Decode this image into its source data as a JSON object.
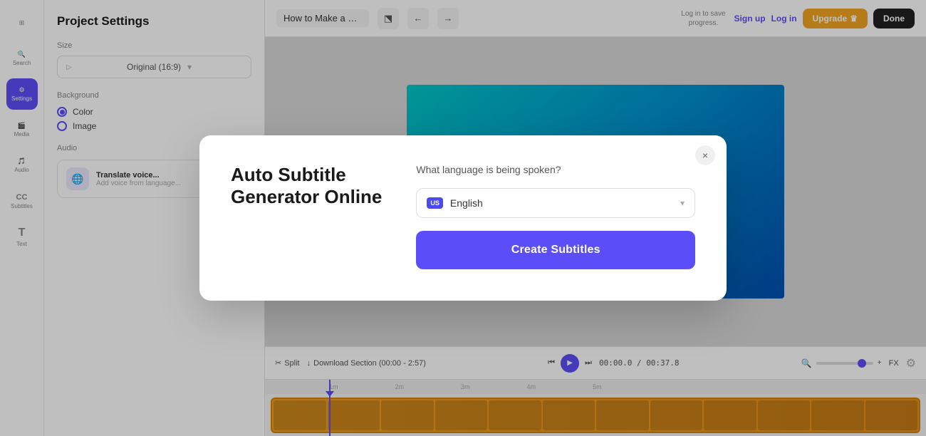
{
  "sidebar": {
    "icons": [
      {
        "name": "grid-icon",
        "label": "",
        "symbol": "⊞",
        "active": false
      },
      {
        "name": "search-icon",
        "label": "Search",
        "symbol": "🔍",
        "active": false
      },
      {
        "name": "settings-icon",
        "label": "Settings",
        "symbol": "⚙",
        "active": true
      },
      {
        "name": "media-icon",
        "label": "Media",
        "symbol": "🎬",
        "active": false
      },
      {
        "name": "audio-icon",
        "label": "Audio",
        "symbol": "🎵",
        "active": false
      },
      {
        "name": "subtitles-icon",
        "label": "Subtitles",
        "symbol": "CC",
        "active": false
      },
      {
        "name": "text-icon",
        "label": "Text",
        "symbol": "T",
        "active": false
      }
    ]
  },
  "settings_panel": {
    "title": "Project Settings",
    "size_label": "Size",
    "size_value": "Original (16:9)",
    "background_label": "Background",
    "bg_options": [
      {
        "label": "Color",
        "selected": true
      },
      {
        "label": "Image",
        "selected": false
      }
    ],
    "audio_label": "Audio",
    "translate_title": "Translate voice...",
    "translate_desc": "Add voice from language..."
  },
  "toolbar": {
    "project_title": "How to Make a Gam...",
    "save_text": "Log in to save\nprogress.",
    "sign_up_label": "Sign up",
    "log_in_label": "Log in",
    "upgrade_label": "Upgrade",
    "done_label": "Done"
  },
  "timeline": {
    "time_current": "00:00.0",
    "time_total": "00:37.8",
    "markers": [
      "",
      "1m",
      "2m",
      "3m",
      "4m",
      "5m"
    ]
  },
  "modal": {
    "title": "Auto Subtitle\nGenerator Online",
    "close_label": "×",
    "question": "What language is being spoken?",
    "language_flag": "US",
    "language_name": "English",
    "create_button_label": "Create Subtitles"
  }
}
